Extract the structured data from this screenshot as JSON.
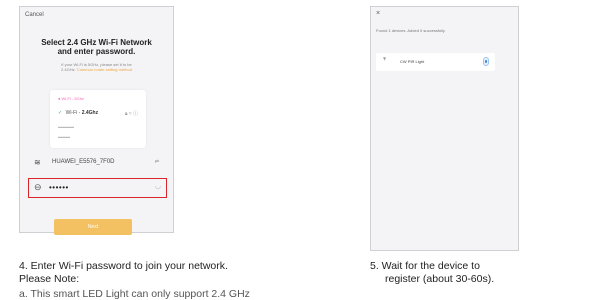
{
  "screen1": {
    "cancel_label": "Cancel",
    "title_line1": "Select 2.4 GHz Wi-Fi Network",
    "title_line2": "and enter password.",
    "hint_line1": "If your Wi-Fi is 5GHz, please set it to be",
    "hint_line2_prefix": "2.4GHz. ",
    "hint_link": "Common router setting method",
    "wifi_option_5g": "Wi-Fi - 5Ghz",
    "wifi_option_24_prefix": "Wi-Fi - ",
    "wifi_option_24_bold": "2.4Ghz",
    "ssid_value": "HUAWEI_E5576_7F0D",
    "ssid_change": "⇄",
    "password_value": "••••••",
    "next_label": "Next"
  },
  "screen2": {
    "close_label": "×",
    "status_text": "Found 1 devices. Added 0 successfully",
    "device_name": "CW PIR Light"
  },
  "captions": {
    "step4": "4. Enter Wi-Fi password to join your network.",
    "note_label": "Please Note:",
    "step4_cut": "a. This smart LED Light can only support 2.4 GHz",
    "step5_line1": "5. Wait for the device to",
    "step5_line2": "register (about 30-60s)."
  },
  "colors": {
    "highlight_border": "#d9262b",
    "next_button": "#f3c062",
    "link": "#f1a33b"
  }
}
